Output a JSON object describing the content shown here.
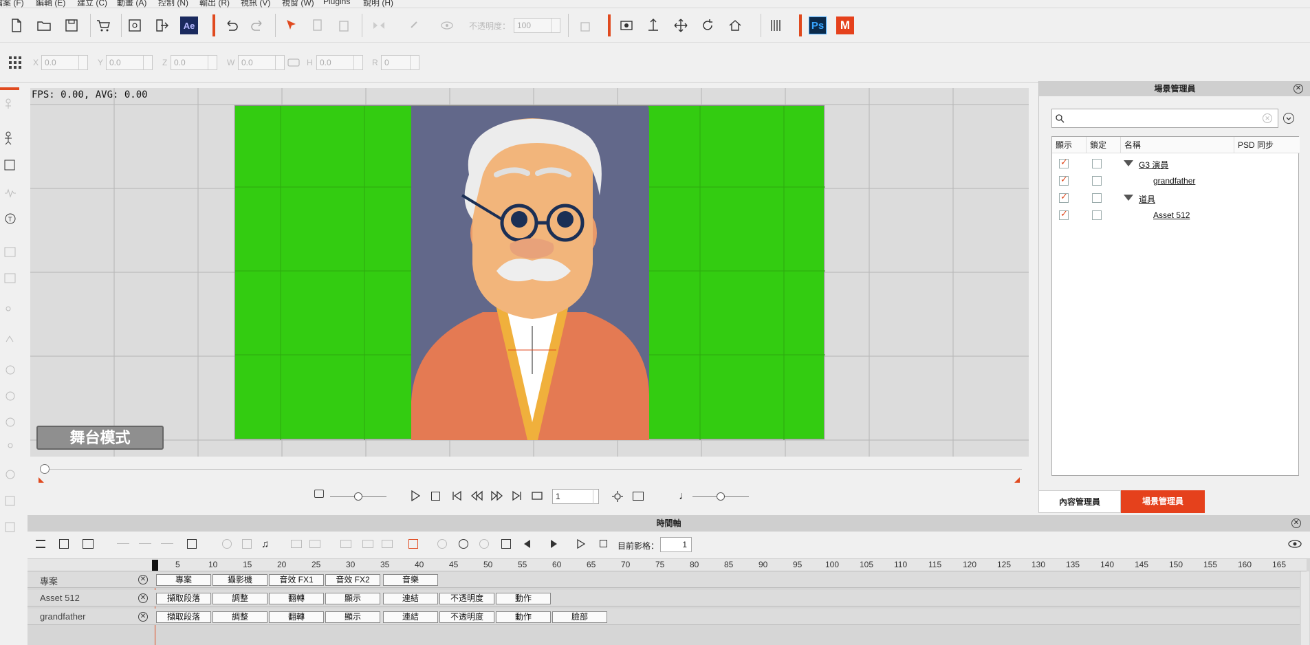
{
  "menubar": {
    "items": [
      "檔案 (F)",
      "編輯 (E)",
      "建立 (C)",
      "動畫 (A)",
      "控制 (N)",
      "輸出 (R)",
      "視訊 (V)",
      "視窗 (W)",
      "Plugins",
      "說明 (H)"
    ]
  },
  "toolbar": {
    "opacity_label": "不透明度：",
    "opacity_value": "100",
    "ae_label": "Ae",
    "ps_label": "Ps",
    "m_label": "M"
  },
  "transform": {
    "x_label": "X",
    "x_value": "0.0",
    "y_label": "Y",
    "y_value": "0.0",
    "z_label": "Z",
    "z_value": "0.0",
    "w_label": "W",
    "w_value": "0.0",
    "h_label": "H",
    "h_value": "0.0",
    "r_label": "R",
    "r_value": "0"
  },
  "viewport": {
    "fps_text": "FPS: 0.00, AVG: 0.00",
    "stage_mode_label": "舞台模式",
    "stage_color": "#33cc11"
  },
  "transport": {
    "frame_value": "1"
  },
  "scene_manager": {
    "title": "場景管理員",
    "search_placeholder": "",
    "columns": [
      "顯示",
      "鎖定",
      "名稱",
      "PSD 同步"
    ],
    "rows": [
      {
        "name": "G3 演員",
        "visible": true,
        "locked": false,
        "level": 0,
        "expanded": true
      },
      {
        "name": "grandfather",
        "visible": true,
        "locked": false,
        "level": 1
      },
      {
        "name": "道具",
        "visible": true,
        "locked": false,
        "level": 0,
        "expanded": true
      },
      {
        "name": "Asset 512",
        "visible": true,
        "locked": false,
        "level": 1
      }
    ],
    "tab_content": "內容管理員",
    "tab_scene": "場景管理員",
    "active_tab_color": "#e5411c"
  },
  "timeline": {
    "title": "時間軸",
    "current_frame_label": "目前影格：",
    "current_frame_value": "1",
    "ruler_ticks": [
      "5",
      "10",
      "15",
      "20",
      "25",
      "30",
      "35",
      "40",
      "45",
      "50",
      "55",
      "60",
      "65",
      "70",
      "75",
      "80",
      "85",
      "90",
      "95",
      "100",
      "105",
      "110",
      "115",
      "120",
      "125",
      "130",
      "135",
      "140",
      "145",
      "150",
      "155",
      "160",
      "165"
    ],
    "tracks": [
      {
        "name": "專案",
        "buttons": [
          "專案",
          "攝影機",
          "音效 FX1",
          "音效 FX2",
          "音樂"
        ]
      },
      {
        "name": "Asset 512",
        "buttons": [
          "擷取段落",
          "調整",
          "翻轉",
          "顯示",
          "連結",
          "不透明度",
          "動作"
        ]
      },
      {
        "name": "grandfather",
        "buttons": [
          "擷取段落",
          "調整",
          "翻轉",
          "顯示",
          "連結",
          "不透明度",
          "動作",
          "臉部"
        ]
      }
    ]
  },
  "icons": [
    "new-file-icon",
    "open-folder-icon",
    "save-icon",
    "cart-icon",
    "export-icon",
    "exit-icon",
    "undo-icon",
    "redo-icon",
    "select-arrow-icon",
    "eye-icon",
    "camera-icon",
    "move-icon",
    "rotate-icon",
    "home-icon",
    "grid-icon",
    "search-icon",
    "close-icon",
    "play-icon",
    "stop-icon"
  ]
}
